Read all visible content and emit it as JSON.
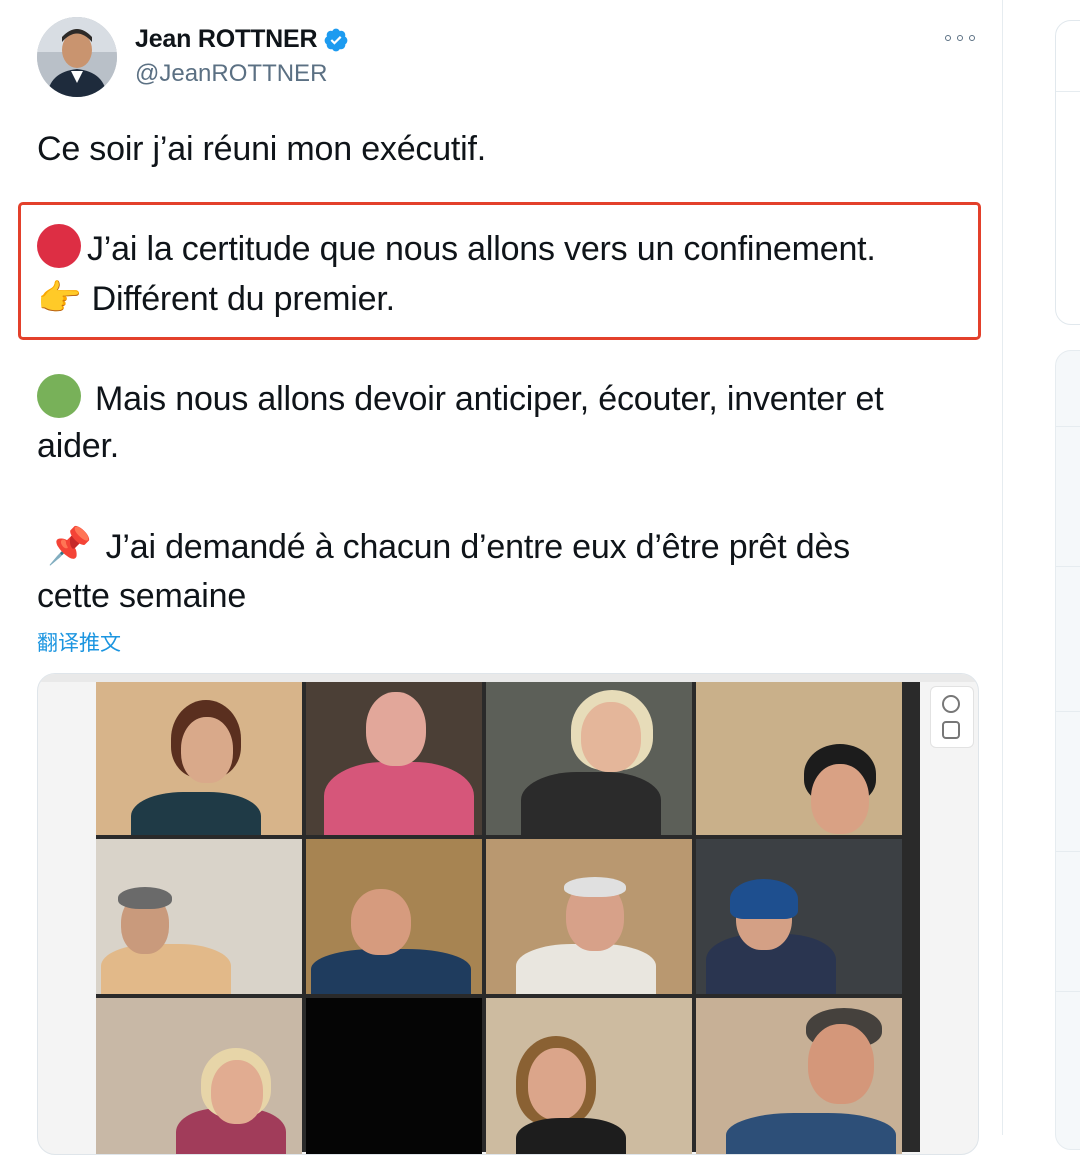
{
  "author": {
    "name": "Jean ROTTNER",
    "handle": "@JeanROTTNER",
    "verified": true
  },
  "tweet": {
    "line1": "Ce soir j’ai réuni mon exécutif.",
    "line2": "J’ai la certitude que nous allons vers un confinement.",
    "line3": "Différent du premier.",
    "line4": "Mais nous allons devoir anticiper, écouter, inventer et",
    "line5": "aider.",
    "line6": "J’ai demandé à chacun d’entre eux d’être prêt dès",
    "line7": "cette semaine",
    "translate_label": "翻译推文"
  },
  "emoji": {
    "red_circle": "red-circle",
    "pointing_hand": "👉",
    "green_circle": "green-circle",
    "pushpin": "📌"
  },
  "colors": {
    "highlight_border": "#e3402b",
    "link": "#1b95e0",
    "verified": "#1d9bf0",
    "red_dot": "#dd2e44",
    "green_dot": "#78b159"
  },
  "media": {
    "description_icons": [
      "participant-video-tile"
    ]
  }
}
